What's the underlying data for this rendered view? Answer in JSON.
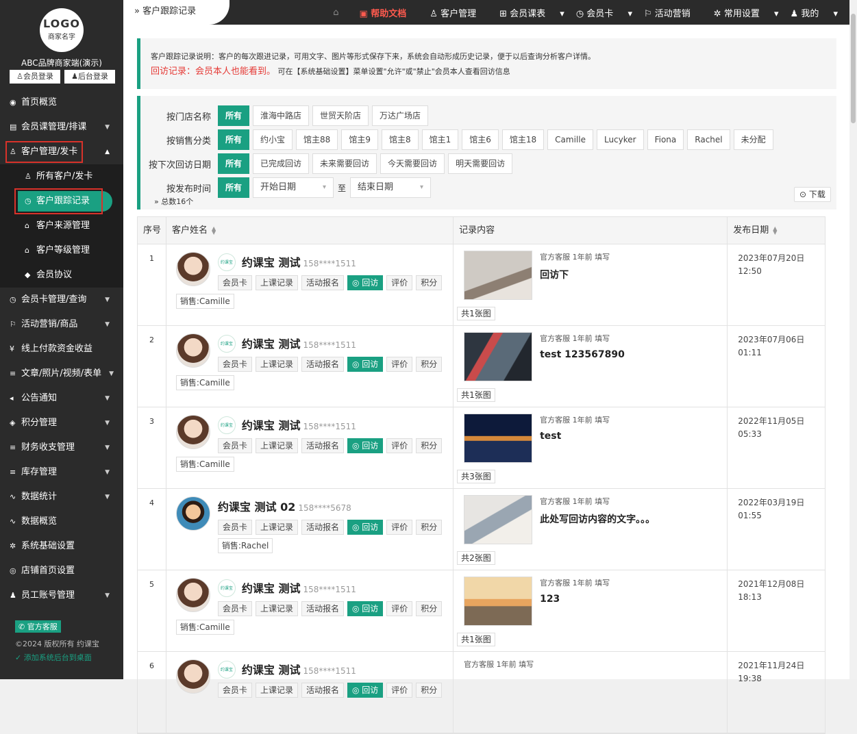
{
  "sidebar": {
    "logo_text": "LOGO",
    "logo_sub": "商家名字",
    "brand": "ABC品牌商家端(演示)",
    "member_login": "会员登录",
    "admin_login": "后台登录",
    "items": [
      {
        "label": "首页概览",
        "icon": "◉"
      },
      {
        "label": "会员课管理/排课",
        "icon": "▤"
      },
      {
        "label": "客户管理/发卡",
        "icon": "♙"
      },
      {
        "label": "会员卡管理/查询",
        "icon": "◷"
      },
      {
        "label": "活动营销/商品",
        "icon": "⚐"
      },
      {
        "label": "线上付款资金收益",
        "icon": "¥"
      },
      {
        "label": "文章/照片/视频/表单",
        "icon": "≡"
      },
      {
        "label": "公告通知",
        "icon": "◂"
      },
      {
        "label": "积分管理",
        "icon": "◈"
      },
      {
        "label": "财务收支管理",
        "icon": "≡"
      },
      {
        "label": "库存管理",
        "icon": "≡"
      },
      {
        "label": "数据统计",
        "icon": "∿"
      },
      {
        "label": "数据概览",
        "icon": "∿"
      },
      {
        "label": "系统基础设置",
        "icon": "✲"
      },
      {
        "label": "店铺首页设置",
        "icon": "◎"
      },
      {
        "label": "员工账号管理",
        "icon": "♟"
      }
    ],
    "subitems": [
      {
        "label": "所有客户/发卡",
        "icon": "♙"
      },
      {
        "label": "客户跟踪记录",
        "icon": "◷"
      },
      {
        "label": "客户来源管理",
        "icon": "⌂"
      },
      {
        "label": "客户等级管理",
        "icon": "⌂"
      },
      {
        "label": "会员协议",
        "icon": "◆"
      }
    ],
    "kefu": "官方客服",
    "copyright": "©2024 版权所有 约课宝",
    "desktop": "添加系统后台到桌面"
  },
  "topbar": {
    "breadcrumb": "客户跟踪记录",
    "help": "帮助文档",
    "customer": "客户管理",
    "courses": "会员课表",
    "card": "会员卡",
    "marketing": "活动营销",
    "settings": "常用设置",
    "mine": "我的"
  },
  "notice": {
    "line1": "客户跟踪记录说明：客户的每次跟进记录，可用文字、图片等形式保存下来，系统会自动形成历史记录，便于以后查询分析客户详情。",
    "line2_red": "回访记录：会员本人也能看到。",
    "line2": "可在【系统基础设置】菜单设置\"允许\"或\"禁止\"会员本人查看回访信息"
  },
  "filters": {
    "store_label": "按门店名称",
    "stores": [
      "所有",
      "淮海中路店",
      "世贸天阶店",
      "万达广场店"
    ],
    "sales_label": "按销售分类",
    "sales": [
      "所有",
      "约小宝",
      "馆主88",
      "馆主9",
      "馆主8",
      "馆主1",
      "馆主6",
      "馆主18",
      "Camille",
      "Lucyker",
      "Fiona",
      "Rachel",
      "未分配"
    ],
    "next_label": "按下次回访日期",
    "next": [
      "所有",
      "已完成回访",
      "未来需要回访",
      "今天需要回访",
      "明天需要回访"
    ],
    "publish_label": "按发布时间",
    "publish_all": "所有",
    "start_date": "开始日期",
    "to": "至",
    "end_date": "结束日期",
    "total": "总数16个",
    "download": "下载"
  },
  "table": {
    "headers": [
      "序号",
      "客户姓名",
      "记录内容",
      "发布日期"
    ],
    "actions": [
      "会员卡",
      "上课记录",
      "活动报名",
      "回访",
      "评价",
      "积分"
    ],
    "badge": "约课宝",
    "rows": [
      {
        "idx": "1",
        "name": "约课宝 测试",
        "phone": "158****1511",
        "sales": "销售:Camille",
        "meta": "官方客服 1年前 填写",
        "text": "回访下",
        "count": "共1张图",
        "date": "2023年07月20日",
        "time": "12:50"
      },
      {
        "idx": "2",
        "name": "约课宝 测试",
        "phone": "158****1511",
        "sales": "销售:Camille",
        "meta": "官方客服 1年前 填写",
        "text": "test 123567890",
        "count": "共1张图",
        "date": "2023年07月06日",
        "time": "01:11"
      },
      {
        "idx": "3",
        "name": "约课宝 测试",
        "phone": "158****1511",
        "sales": "销售:Camille",
        "meta": "官方客服 1年前 填写",
        "text": "test",
        "count": "共3张图",
        "date": "2022年11月05日",
        "time": "05:33"
      },
      {
        "idx": "4",
        "name": "约课宝 测试 02",
        "phone": "158****5678",
        "sales": "销售:Rachel",
        "meta": "官方客服 1年前 填写",
        "text": "此处写回访内容的文字。。。",
        "count": "共2张图",
        "date": "2022年03月19日",
        "time": "01:55"
      },
      {
        "idx": "5",
        "name": "约课宝 测试",
        "phone": "158****1511",
        "sales": "销售:Camille",
        "meta": "官方客服 1年前 填写",
        "text": "123",
        "count": "共1张图",
        "date": "2021年12月08日",
        "time": "18:13"
      },
      {
        "idx": "6",
        "name": "约课宝 测试",
        "phone": "158****1511",
        "sales": "",
        "meta": "官方客服 1年前 填写",
        "text": "",
        "count": "",
        "date": "2021年11月24日",
        "time": "19:38"
      }
    ]
  },
  "colors": {
    "accent": "#1aa082",
    "help": "#ff5a4e",
    "highlight": "#d9322a",
    "sidebar_bg": "#2b2b2b"
  }
}
